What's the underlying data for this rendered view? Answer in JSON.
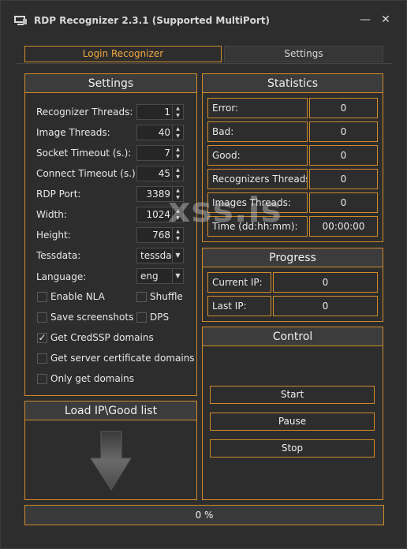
{
  "window": {
    "title": "RDP Recognizer 2.3.1 (Supported MultiPort)",
    "minimize": "—",
    "close": "✕"
  },
  "tabs": [
    {
      "label": "Login Recognizer",
      "active": true
    },
    {
      "label": "Settings",
      "active": false
    }
  ],
  "settings": {
    "header": "Settings",
    "recognizer_threads": {
      "label": "Recognizer Threads:",
      "value": "1"
    },
    "image_threads": {
      "label": "Image Threads:",
      "value": "40"
    },
    "socket_timeout": {
      "label": "Socket Timeout (s.):",
      "value": "7"
    },
    "connect_timeout": {
      "label": "Connect Timeout (s.)",
      "value": "45"
    },
    "rdp_port": {
      "label": "RDP Port:",
      "value": "3389"
    },
    "width": {
      "label": "Width:",
      "value": "1024"
    },
    "height": {
      "label": "Height:",
      "value": "768"
    },
    "tessdata": {
      "label": "Tessdata:",
      "value": "tessda"
    },
    "language": {
      "label": "Language:",
      "value": "eng"
    },
    "enable_nla": {
      "label": "Enable NLA",
      "checked": false
    },
    "shuffle": {
      "label": "Shuffle",
      "checked": false
    },
    "save_screenshots": {
      "label": "Save screenshots",
      "checked": false
    },
    "dps": {
      "label": "DPS",
      "checked": false
    },
    "get_credssp": {
      "label": "Get CredSSP domains",
      "checked": true
    },
    "get_server_cert": {
      "label": "Get server certificate domains",
      "checked": false
    },
    "only_get_domains": {
      "label": "Only get domains",
      "checked": false
    }
  },
  "load": {
    "header": "Load IP\\Good list"
  },
  "statistics": {
    "header": "Statistics",
    "rows": [
      {
        "label": "Error:",
        "value": "0"
      },
      {
        "label": "Bad:",
        "value": "0"
      },
      {
        "label": "Good:",
        "value": "0"
      },
      {
        "label": "Recognizers Threads:",
        "value": "0"
      },
      {
        "label": "Images Threads:",
        "value": "0"
      },
      {
        "label": "Time (dd:hh:mm):",
        "value": "00:00:00"
      }
    ]
  },
  "progress": {
    "header": "Progress",
    "current_ip": {
      "label": "Current IP:",
      "value": "0"
    },
    "last_ip": {
      "label": "Last IP:",
      "value": "0"
    }
  },
  "control": {
    "header": "Control",
    "start": "Start",
    "pause": "Pause",
    "stop": "Stop"
  },
  "progress_bar": {
    "text": "0 %",
    "fraction": 0
  },
  "watermark": "xss.is",
  "colors": {
    "accent": "#d08b2b",
    "background": "#2d2d2d",
    "header": "#3c3c3c"
  },
  "icons": {
    "app": "rdp-app-icon",
    "drop": "down-arrow-icon"
  }
}
